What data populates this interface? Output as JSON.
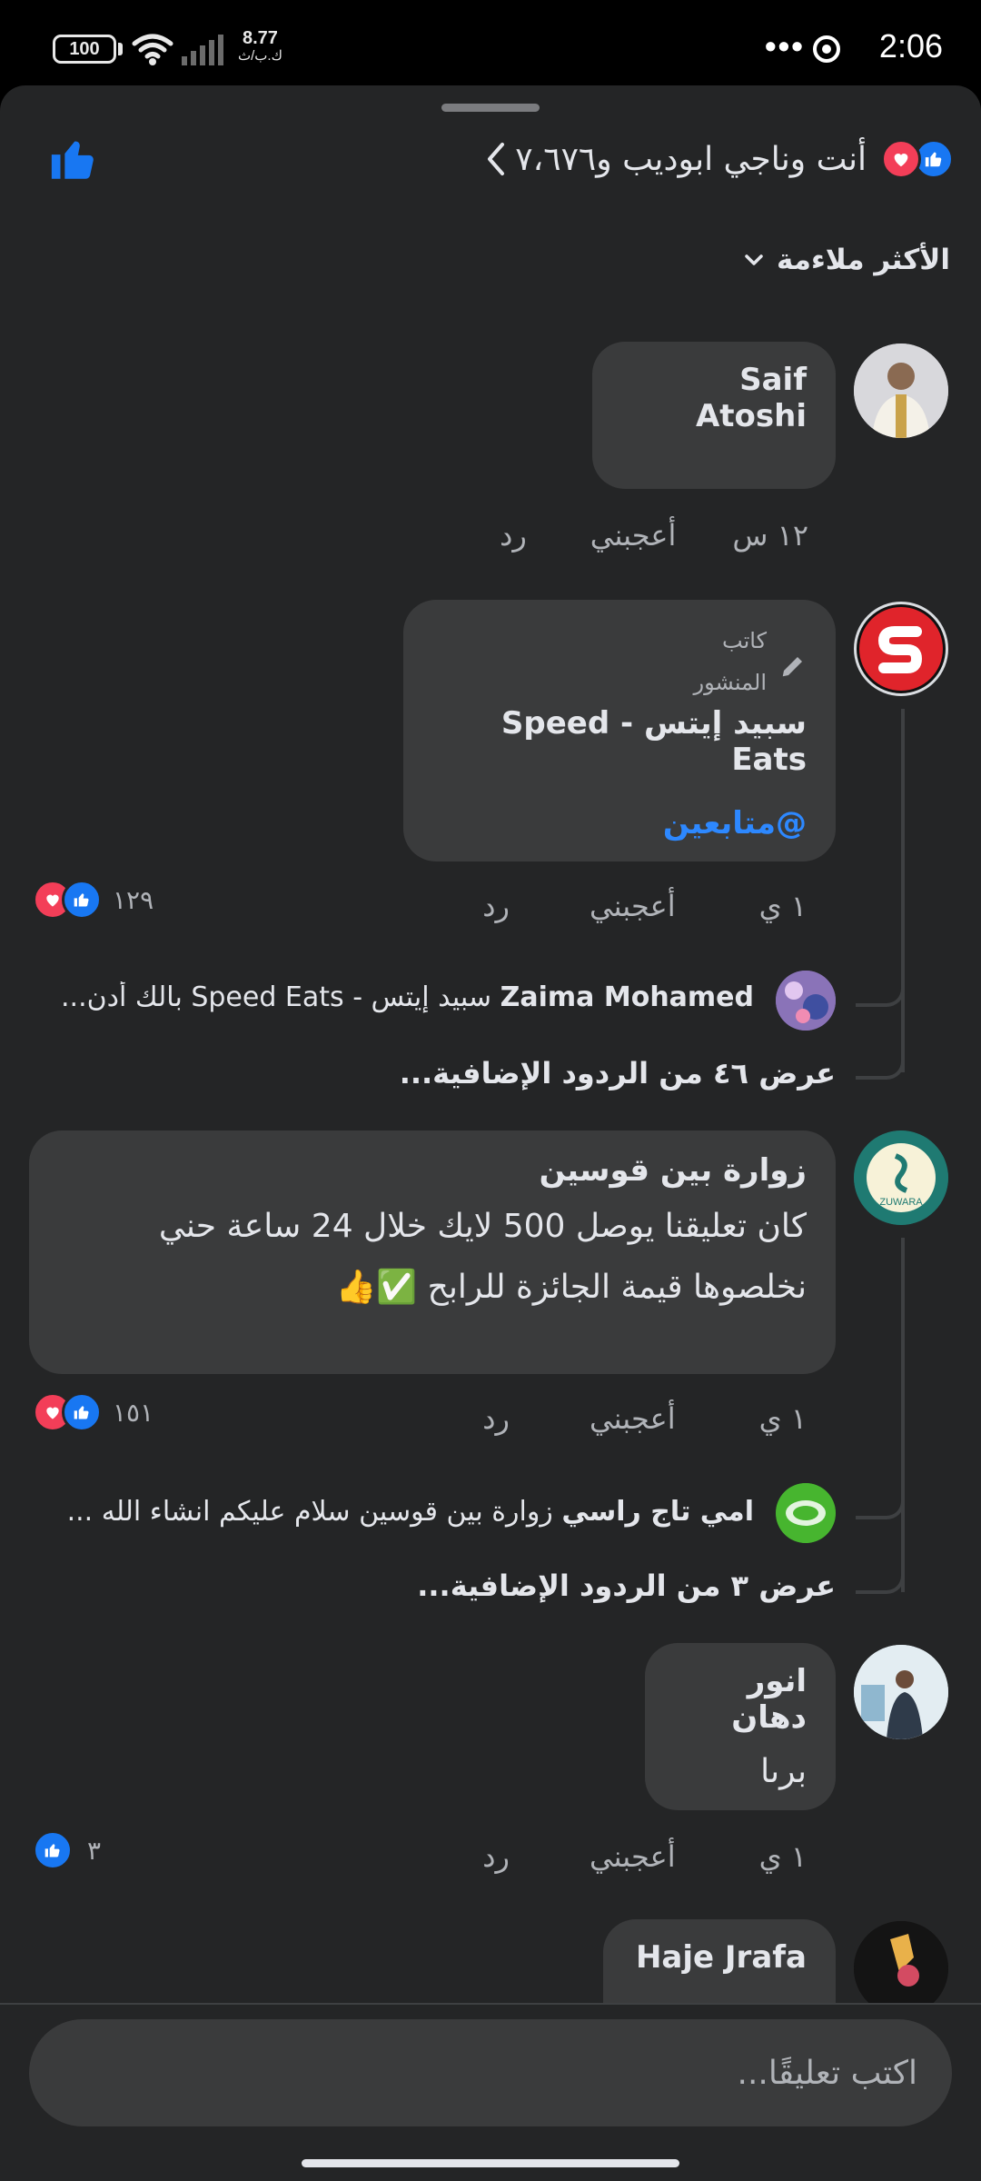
{
  "status_bar": {
    "battery": "100",
    "net_speed": "8.77",
    "net_unit": "ك.ب/ث",
    "time": "2:06",
    "more_dots": "•••"
  },
  "header": {
    "reactions_text": "أنت وناجي ابوديب و٧،٦٧٦"
  },
  "sort": {
    "label": "الأكثر ملاءمة"
  },
  "comments": [
    {
      "name": "Saif Atoshi",
      "body": "",
      "time": "١٢ س",
      "like_label": "أعجبني",
      "reply_label": "رد"
    },
    {
      "author_badge_line1": "كاتب",
      "author_badge_line2": "المنشور",
      "name": "سبيد إيتس - Speed Eats",
      "mention": "@متابعين",
      "time": "١ ي",
      "like_label": "أعجبني",
      "reply_label": "رد",
      "reaction_count": "١٢٩",
      "reply_preview": {
        "name": "Zaima Mohamed",
        "text": "سبيد إيتس - Speed Eats  بالك أدن..."
      },
      "more_replies": "عرض ٤٦ من الردود الإضافية..."
    },
    {
      "name": "زوارة بين قوسين",
      "body_line1": "كان تعليقنا يوصل 500 لايك خلال 24 ساعة حني",
      "body_line2": "نخلصوها قيمة الجائزة للرابح ✅👍",
      "time": "١ ي",
      "like_label": "أعجبني",
      "reply_label": "رد",
      "reaction_count": "١٥١",
      "reply_preview": {
        "name": "امي تاج راسي",
        "text": "زوارة بين قوسين سلام عليكم  انشاء الله ..."
      },
      "more_replies": "عرض ٣ من الردود الإضافية..."
    },
    {
      "name": "انور دهان",
      "body": "برىا",
      "time": "١ ي",
      "like_label": "أعجبني",
      "reply_label": "رد",
      "reaction_count": "٣"
    },
    {
      "name": "Haje Jrafa"
    }
  ],
  "composer": {
    "placeholder": "اكتب تعليقًا..."
  },
  "colors": {
    "like_blue": "#1877f2",
    "love_red": "#f33e58",
    "sheet_bg": "#242526",
    "bubble_bg": "#3a3b3c",
    "mention_blue": "#2d88ff"
  }
}
